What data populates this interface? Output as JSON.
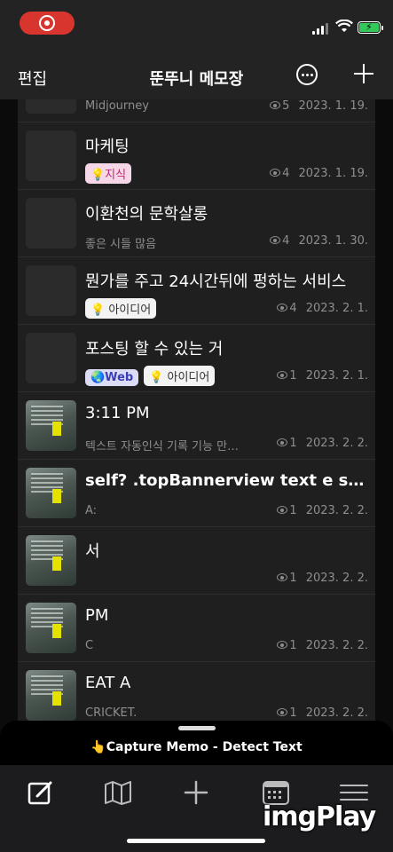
{
  "header": {
    "edit_label": "편집",
    "title": "뚠뚜니 메모장"
  },
  "memos": [
    {
      "title": "",
      "subtitle": "Midjourney",
      "views": "5",
      "date": "2023. 1. 19.",
      "thumbnail": "blank"
    },
    {
      "title": "마케팅",
      "tags": [
        {
          "label": "💡지식",
          "style": "pink"
        }
      ],
      "views": "4",
      "date": "2023. 1. 19.",
      "thumbnail": "blank"
    },
    {
      "title": "이환천의 문학살롱",
      "subtitle": "좋은 시들 많음",
      "views": "4",
      "date": "2023. 1. 30.",
      "thumbnail": "blank"
    },
    {
      "title": "뭔가를 주고 24시간뒤에 펑하는 서비스",
      "tags": [
        {
          "label": "💡 아이디어",
          "style": "white"
        }
      ],
      "views": "4",
      "date": "2023. 2. 1.",
      "thumbnail": "blank"
    },
    {
      "title": "포스팅 할 수 있는 거",
      "tags": [
        {
          "label": "🌏Web",
          "style": "web"
        },
        {
          "label": "💡 아이디어",
          "style": "white"
        }
      ],
      "views": "1",
      "date": "2023. 2. 1.",
      "thumbnail": "blank"
    },
    {
      "title": "3:11 PM",
      "subtitle": "텍스트 자동인식 기록 기능 만…",
      "views": "1",
      "date": "2023. 2. 2.",
      "thumbnail": "photo"
    },
    {
      "title": "self? .topBannerview text e stri...",
      "subtitle": "A:",
      "views": "1",
      "date": "2023. 2. 2.",
      "thumbnail": "photo"
    },
    {
      "title": "서",
      "subtitle": "",
      "views": "1",
      "date": "2023. 2. 2.",
      "thumbnail": "photo"
    },
    {
      "title": "PM",
      "subtitle": "C",
      "views": "1",
      "date": "2023. 2. 2.",
      "thumbnail": "photo"
    },
    {
      "title": "EAT A",
      "subtitle": "CRICKET.",
      "views": "1",
      "date": "2023. 2. 2.",
      "thumbnail": "photo"
    }
  ],
  "banner": {
    "text": "👆Capture Memo - Detect Text"
  },
  "tabbar": {
    "icons": [
      "memo-edit-icon",
      "map-icon",
      "plus-icon",
      "calendar-icon",
      "menu-icon"
    ]
  },
  "watermark": "imgPlay",
  "colors": {
    "record": "#d9352f",
    "battery": "#34c759",
    "background": "#1f1f1f"
  }
}
